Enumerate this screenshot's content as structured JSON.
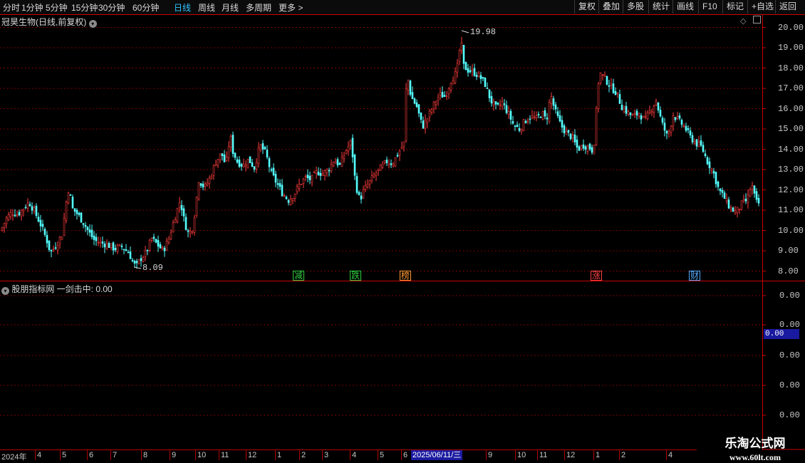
{
  "periods": [
    "分时",
    "1分钟",
    "5分钟",
    "15分钟",
    "30分钟",
    "60分钟",
    "日线",
    "周线",
    "月线",
    "多周期",
    "更多 >"
  ],
  "active_period": "日线",
  "toolbar": [
    "复权",
    "叠加",
    "多股",
    "统计",
    "画线",
    "F10",
    "标记",
    "+自选",
    "返回"
  ],
  "main_chart": {
    "title": "冠昊生物(日线,前复权)",
    "high_label": "19.98",
    "low_label": "8.09",
    "y_ticks": [
      "20.00",
      "19.00",
      "18.00",
      "17.00",
      "16.00",
      "15.00",
      "14.00",
      "13.00",
      "12.00",
      "11.00",
      "10.00",
      "9.00",
      "8.00"
    ]
  },
  "signals": [
    {
      "text": "减",
      "color": "#2ecc40"
    },
    {
      "text": "跌",
      "color": "#2ecc40"
    },
    {
      "text": "榜",
      "color": "#ff9933"
    },
    {
      "text": "涨",
      "color": "#ff4040"
    },
    {
      "text": "财",
      "color": "#55aaff"
    }
  ],
  "indicator": {
    "title": "股朋指标网 一剑击中: 0.00",
    "y_ticks": [
      "0.00",
      "0.00",
      "0.00",
      "0.00",
      "0.00"
    ],
    "current_value": "0.00"
  },
  "date_axis": {
    "ticks": [
      "2024年",
      "4",
      "5",
      "6",
      "7",
      "8",
      "9",
      "10",
      "11",
      "12",
      "1",
      "2",
      "3",
      "4",
      "5",
      "6",
      "9",
      "10",
      "11",
      "12",
      "1",
      "2",
      "4"
    ],
    "cursor": "2025/06/11/三"
  },
  "watermark": {
    "title": "乐淘公式网",
    "url": "www.60lt.com"
  },
  "colors": {
    "up": "#ff3b3b",
    "down": "#54ffff",
    "grid": "#7a0000",
    "axis": "#c80000"
  },
  "chart_data": {
    "type": "candlestick",
    "title": "冠昊生物(日线,前复权)",
    "ylim": [
      7.6,
      20.3
    ],
    "close_path": [
      [
        0,
        10.0
      ],
      [
        8,
        10.6
      ],
      [
        16,
        10.9
      ],
      [
        24,
        10.8
      ],
      [
        32,
        11.1
      ],
      [
        40,
        11.4
      ],
      [
        48,
        10.9
      ],
      [
        56,
        10.3
      ],
      [
        64,
        9.6
      ],
      [
        70,
        8.9
      ],
      [
        78,
        9.3
      ],
      [
        86,
        9.8
      ],
      [
        92,
        11.4
      ],
      [
        96,
        12.2
      ],
      [
        100,
        11.1
      ],
      [
        108,
        10.8
      ],
      [
        116,
        10.4
      ],
      [
        124,
        9.9
      ],
      [
        132,
        9.5
      ],
      [
        140,
        9.4
      ],
      [
        150,
        9.3
      ],
      [
        160,
        9.1
      ],
      [
        170,
        9.2
      ],
      [
        180,
        8.9
      ],
      [
        186,
        8.4
      ],
      [
        190,
        8.2
      ],
      [
        196,
        8.6
      ],
      [
        204,
        8.9
      ],
      [
        212,
        9.6
      ],
      [
        220,
        9.3
      ],
      [
        228,
        9.0
      ],
      [
        236,
        9.6
      ],
      [
        244,
        10.6
      ],
      [
        252,
        11.5
      ],
      [
        258,
        10.4
      ],
      [
        264,
        9.8
      ],
      [
        270,
        10.2
      ],
      [
        278,
        12.5
      ],
      [
        286,
        12.1
      ],
      [
        294,
        12.6
      ],
      [
        302,
        13.4
      ],
      [
        310,
        13.8
      ],
      [
        316,
        13.2
      ],
      [
        322,
        14.7
      ],
      [
        326,
        13.9
      ],
      [
        332,
        13.4
      ],
      [
        340,
        13.2
      ],
      [
        348,
        13.5
      ],
      [
        356,
        13.1
      ],
      [
        364,
        14.2
      ],
      [
        372,
        13.8
      ],
      [
        380,
        12.8
      ],
      [
        388,
        12.3
      ],
      [
        396,
        11.8
      ],
      [
        404,
        11.5
      ],
      [
        412,
        11.8
      ],
      [
        420,
        12.3
      ],
      [
        428,
        12.6
      ],
      [
        436,
        12.5
      ],
      [
        444,
        12.9
      ],
      [
        452,
        12.8
      ],
      [
        460,
        13.0
      ],
      [
        468,
        13.5
      ],
      [
        476,
        13.2
      ],
      [
        484,
        13.9
      ],
      [
        492,
        14.4
      ],
      [
        498,
        12.3
      ],
      [
        504,
        11.5
      ],
      [
        510,
        12.0
      ],
      [
        518,
        12.4
      ],
      [
        526,
        12.8
      ],
      [
        534,
        13.1
      ],
      [
        542,
        13.4
      ],
      [
        550,
        13.3
      ],
      [
        558,
        13.8
      ],
      [
        566,
        14.3
      ],
      [
        570,
        17.8
      ],
      [
        576,
        16.6
      ],
      [
        584,
        16.1
      ],
      [
        592,
        15.1
      ],
      [
        600,
        15.6
      ],
      [
        608,
        16.2
      ],
      [
        616,
        16.7
      ],
      [
        624,
        16.6
      ],
      [
        632,
        17.4
      ],
      [
        640,
        17.8
      ],
      [
        646,
        19.4
      ],
      [
        650,
        18.1
      ],
      [
        656,
        17.9
      ],
      [
        664,
        17.8
      ],
      [
        672,
        17.6
      ],
      [
        680,
        17.2
      ],
      [
        688,
        16.4
      ],
      [
        696,
        16.0
      ],
      [
        704,
        16.3
      ],
      [
        712,
        15.8
      ],
      [
        720,
        15.2
      ],
      [
        728,
        15.0
      ],
      [
        736,
        15.4
      ],
      [
        744,
        15.6
      ],
      [
        752,
        15.5
      ],
      [
        760,
        15.8
      ],
      [
        766,
        15.4
      ],
      [
        772,
        16.7
      ],
      [
        778,
        15.9
      ],
      [
        786,
        15.2
      ],
      [
        794,
        14.8
      ],
      [
        802,
        14.6
      ],
      [
        810,
        14.0
      ],
      [
        818,
        14.2
      ],
      [
        826,
        14.1
      ],
      [
        832,
        13.9
      ],
      [
        840,
        17.8
      ],
      [
        848,
        17.5
      ],
      [
        856,
        17.1
      ],
      [
        864,
        16.8
      ],
      [
        872,
        16.1
      ],
      [
        880,
        15.8
      ],
      [
        888,
        15.6
      ],
      [
        896,
        15.8
      ],
      [
        904,
        15.4
      ],
      [
        912,
        15.9
      ],
      [
        920,
        16.4
      ],
      [
        928,
        15.3
      ],
      [
        936,
        14.6
      ],
      [
        944,
        15.7
      ],
      [
        952,
        15.4
      ],
      [
        960,
        15.1
      ],
      [
        968,
        14.6
      ],
      [
        976,
        14.3
      ],
      [
        984,
        14.1
      ],
      [
        992,
        13.4
      ],
      [
        1000,
        12.9
      ],
      [
        1008,
        12.0
      ],
      [
        1016,
        11.6
      ],
      [
        1024,
        11.1
      ],
      [
        1032,
        10.9
      ],
      [
        1040,
        11.3
      ],
      [
        1048,
        11.5
      ],
      [
        1054,
        12.3
      ],
      [
        1060,
        11.4
      ],
      [
        1066,
        11.3
      ]
    ]
  }
}
